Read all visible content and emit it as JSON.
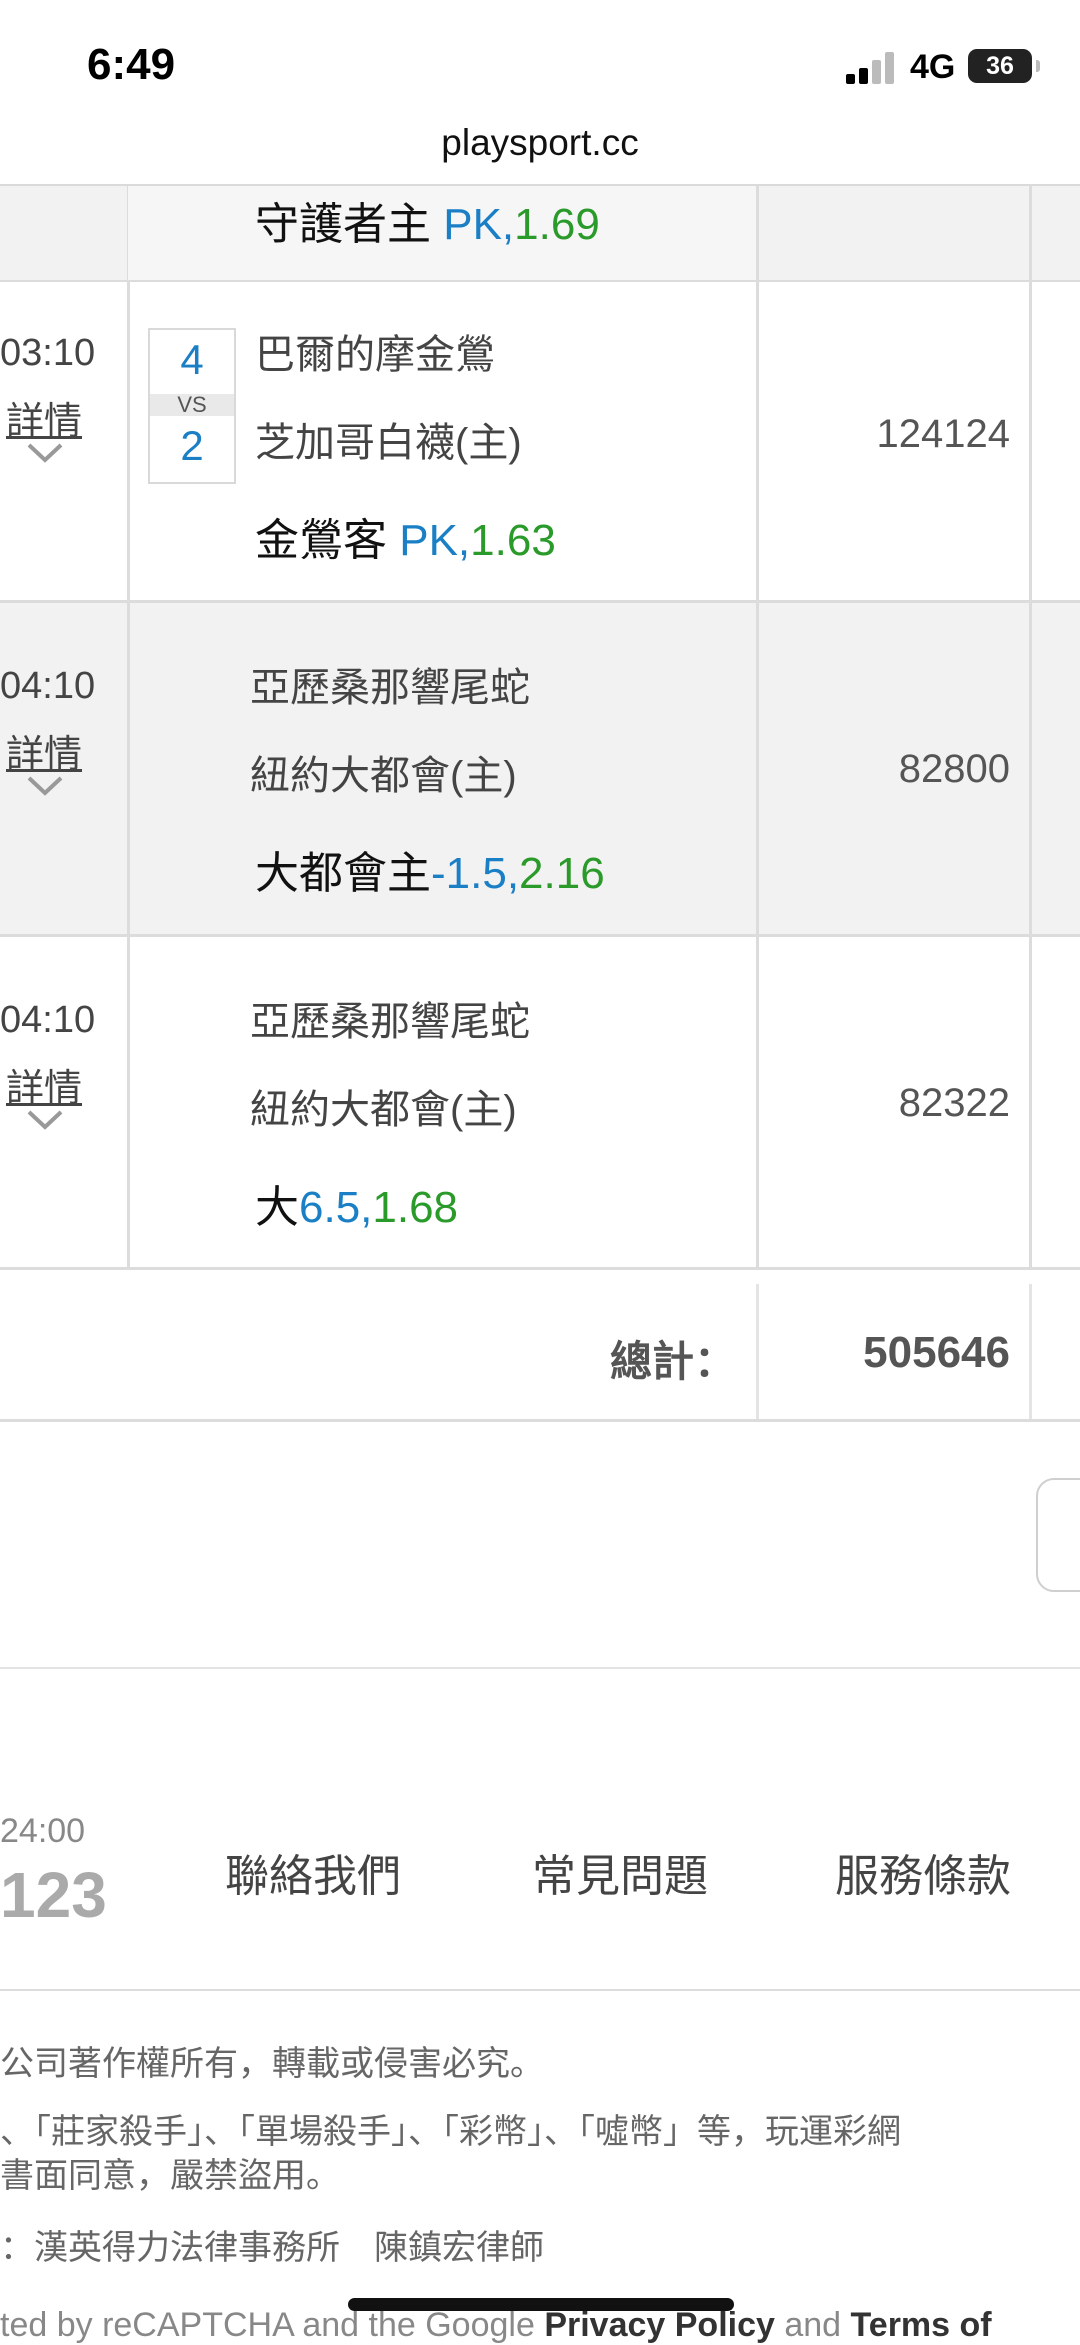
{
  "status": {
    "time": "6:49",
    "network": "4G",
    "battery": "36"
  },
  "browser": {
    "url": "playsport.cc"
  },
  "top_row": {
    "pick_team": "守護者主",
    "pick_line": "PK,",
    "pick_odds": "1.69"
  },
  "rows": [
    {
      "time": "03:10",
      "detail": "詳情",
      "team1": "巴爾的摩金鶯",
      "team2": "芝加哥白襪(主)",
      "score1": "4",
      "vs": "VS",
      "score2": "2",
      "pick_team": "金鶯客",
      "pick_line": "PK,",
      "pick_odds": "1.63",
      "amount": "124124"
    },
    {
      "time": "04:10",
      "detail": "詳情",
      "team1": "亞歷桑那響尾蛇",
      "team2": "紐約大都會(主)",
      "pick_team": "大都會主",
      "pick_line": "-1.5,",
      "pick_odds": "2.16",
      "amount": "82800"
    },
    {
      "time": "04:10",
      "detail": "詳情",
      "team1": "亞歷桑那響尾蛇",
      "team2": "紐約大都會(主)",
      "pick_team": "大",
      "pick_line": "6.5,",
      "pick_odds": "1.68",
      "amount": "82322"
    }
  ],
  "total": {
    "label": "總計：",
    "value": "505646"
  },
  "footer": {
    "time": "24:00",
    "number": "123",
    "links": [
      "聯絡我們",
      "常見問題",
      "服務條款"
    ],
    "copyright": "公司著作權所有，轉載或侵害必究。",
    "trademark_1": "、「莊家殺手」、「單場殺手」、「彩幣」、「噓幣」等，玩運彩網",
    "trademark_2": "書面同意，嚴禁盜用。",
    "lawyer": "：漢英得力法律事務所　陳鎮宏律師",
    "recaptcha_prefix": "ted by reCAPTCHA and the Google ",
    "privacy": "Privacy Policy",
    "and": " and ",
    "terms": "Terms of"
  }
}
